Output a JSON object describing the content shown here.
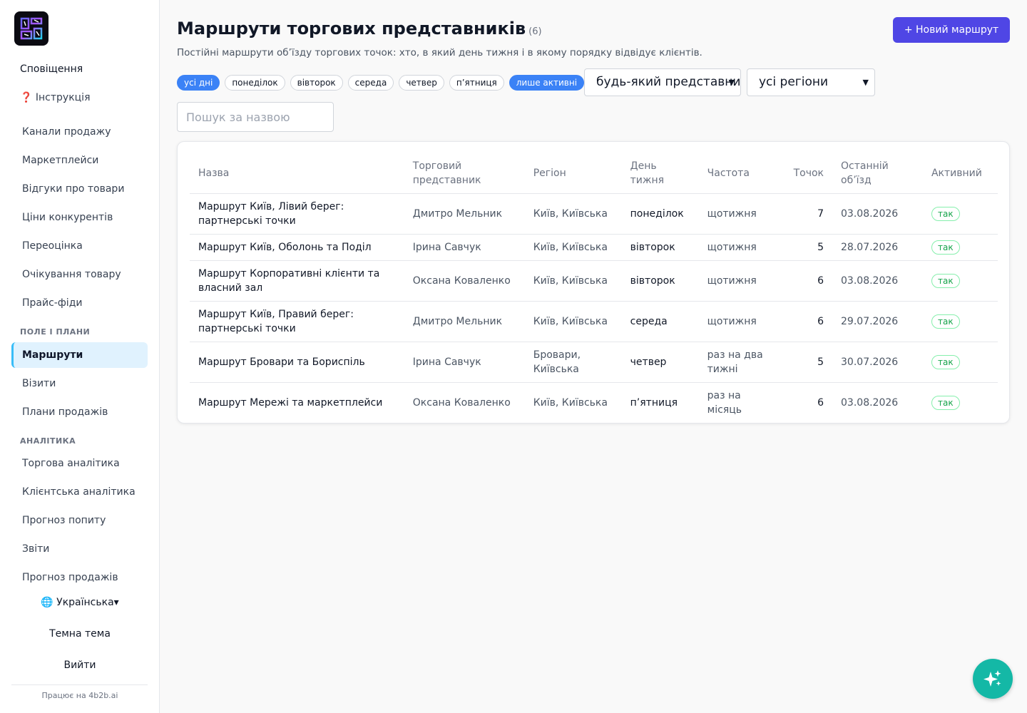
{
  "colors": {
    "accent": "#4f46e5",
    "chip_active": "#3b82f6",
    "active_nav_bg": "#e0f2fe",
    "badge_green": "#16a34a",
    "fab": "#14b8a6"
  },
  "sidebar": {
    "notifications": "Сповіщення",
    "help": "❓ Інструкція",
    "items_a": [
      "Канали продажу",
      "Маркетплейси",
      "Відгуки про товари",
      "Ціни конкурентів",
      "Переоцінка",
      "Очікування товару",
      "Прайс-фіди"
    ],
    "section_field": "ПОЛЕ І ПЛАНИ",
    "items_b": [
      "Маршрути",
      "Візити",
      "Плани продажів"
    ],
    "section_analytics": "АНАЛІТИКА",
    "items_c": [
      "Торгова аналітика",
      "Клієнтська аналітика",
      "Прогноз попиту",
      "Звіти",
      "Прогноз продажів"
    ],
    "language": "🌐 Українська▾",
    "theme": "Темна тема",
    "logout": "Вийти",
    "powered": "Працює на 4b2b.ai"
  },
  "header": {
    "title": "Маршрути торгових представників",
    "count": "(6)",
    "subtitle": "Постійні маршрути об’їзду торгових точок: хто, в який день тижня і в якому порядку відвідує клієнтів.",
    "new_button": "+ Новий маршрут"
  },
  "filters": {
    "chips": [
      "усі дні",
      "понеділок",
      "вівторок",
      "середа",
      "четвер",
      "п’ятниця",
      "лише активні"
    ],
    "rep_select": "будь-який представник",
    "region_select": "усі регіони",
    "search_placeholder": "Пошук за назвою"
  },
  "table": {
    "columns": [
      "Назва",
      "Торговий представник",
      "Регіон",
      "День тижня",
      "Частота",
      "Точок",
      "Останній об’їзд",
      "Активний"
    ],
    "rows": [
      [
        "Маршрут Київ, Лівий берег: партнерські точки",
        "Дмитро Мельник",
        "Київ, Київська",
        "понеділок",
        "щотижня",
        "7",
        "03.08.2026",
        "так"
      ],
      [
        "Маршрут Київ, Оболонь та Поділ",
        "Ірина Савчук",
        "Київ, Київська",
        "вівторок",
        "щотижня",
        "5",
        "28.07.2026",
        "так"
      ],
      [
        "Маршрут Корпоративні клієнти та власний зал",
        "Оксана Коваленко",
        "Київ, Київська",
        "вівторок",
        "щотижня",
        "6",
        "03.08.2026",
        "так"
      ],
      [
        "Маршрут Київ, Правий берег: партнерські точки",
        "Дмитро Мельник",
        "Київ, Київська",
        "середа",
        "щотижня",
        "6",
        "29.07.2026",
        "так"
      ],
      [
        "Маршрут Бровари та Бориспіль",
        "Ірина Савчук",
        "Бровари, Київська",
        "четвер",
        "раз на два тижні",
        "5",
        "30.07.2026",
        "так"
      ],
      [
        "Маршрут Мережі та маркетплейси",
        "Оксана Коваленко",
        "Київ, Київська",
        "п’ятниця",
        "раз на місяць",
        "6",
        "03.08.2026",
        "так"
      ]
    ]
  },
  "icons": {
    "logo": "4b2b-logo",
    "fab": "sparkles-icon"
  }
}
